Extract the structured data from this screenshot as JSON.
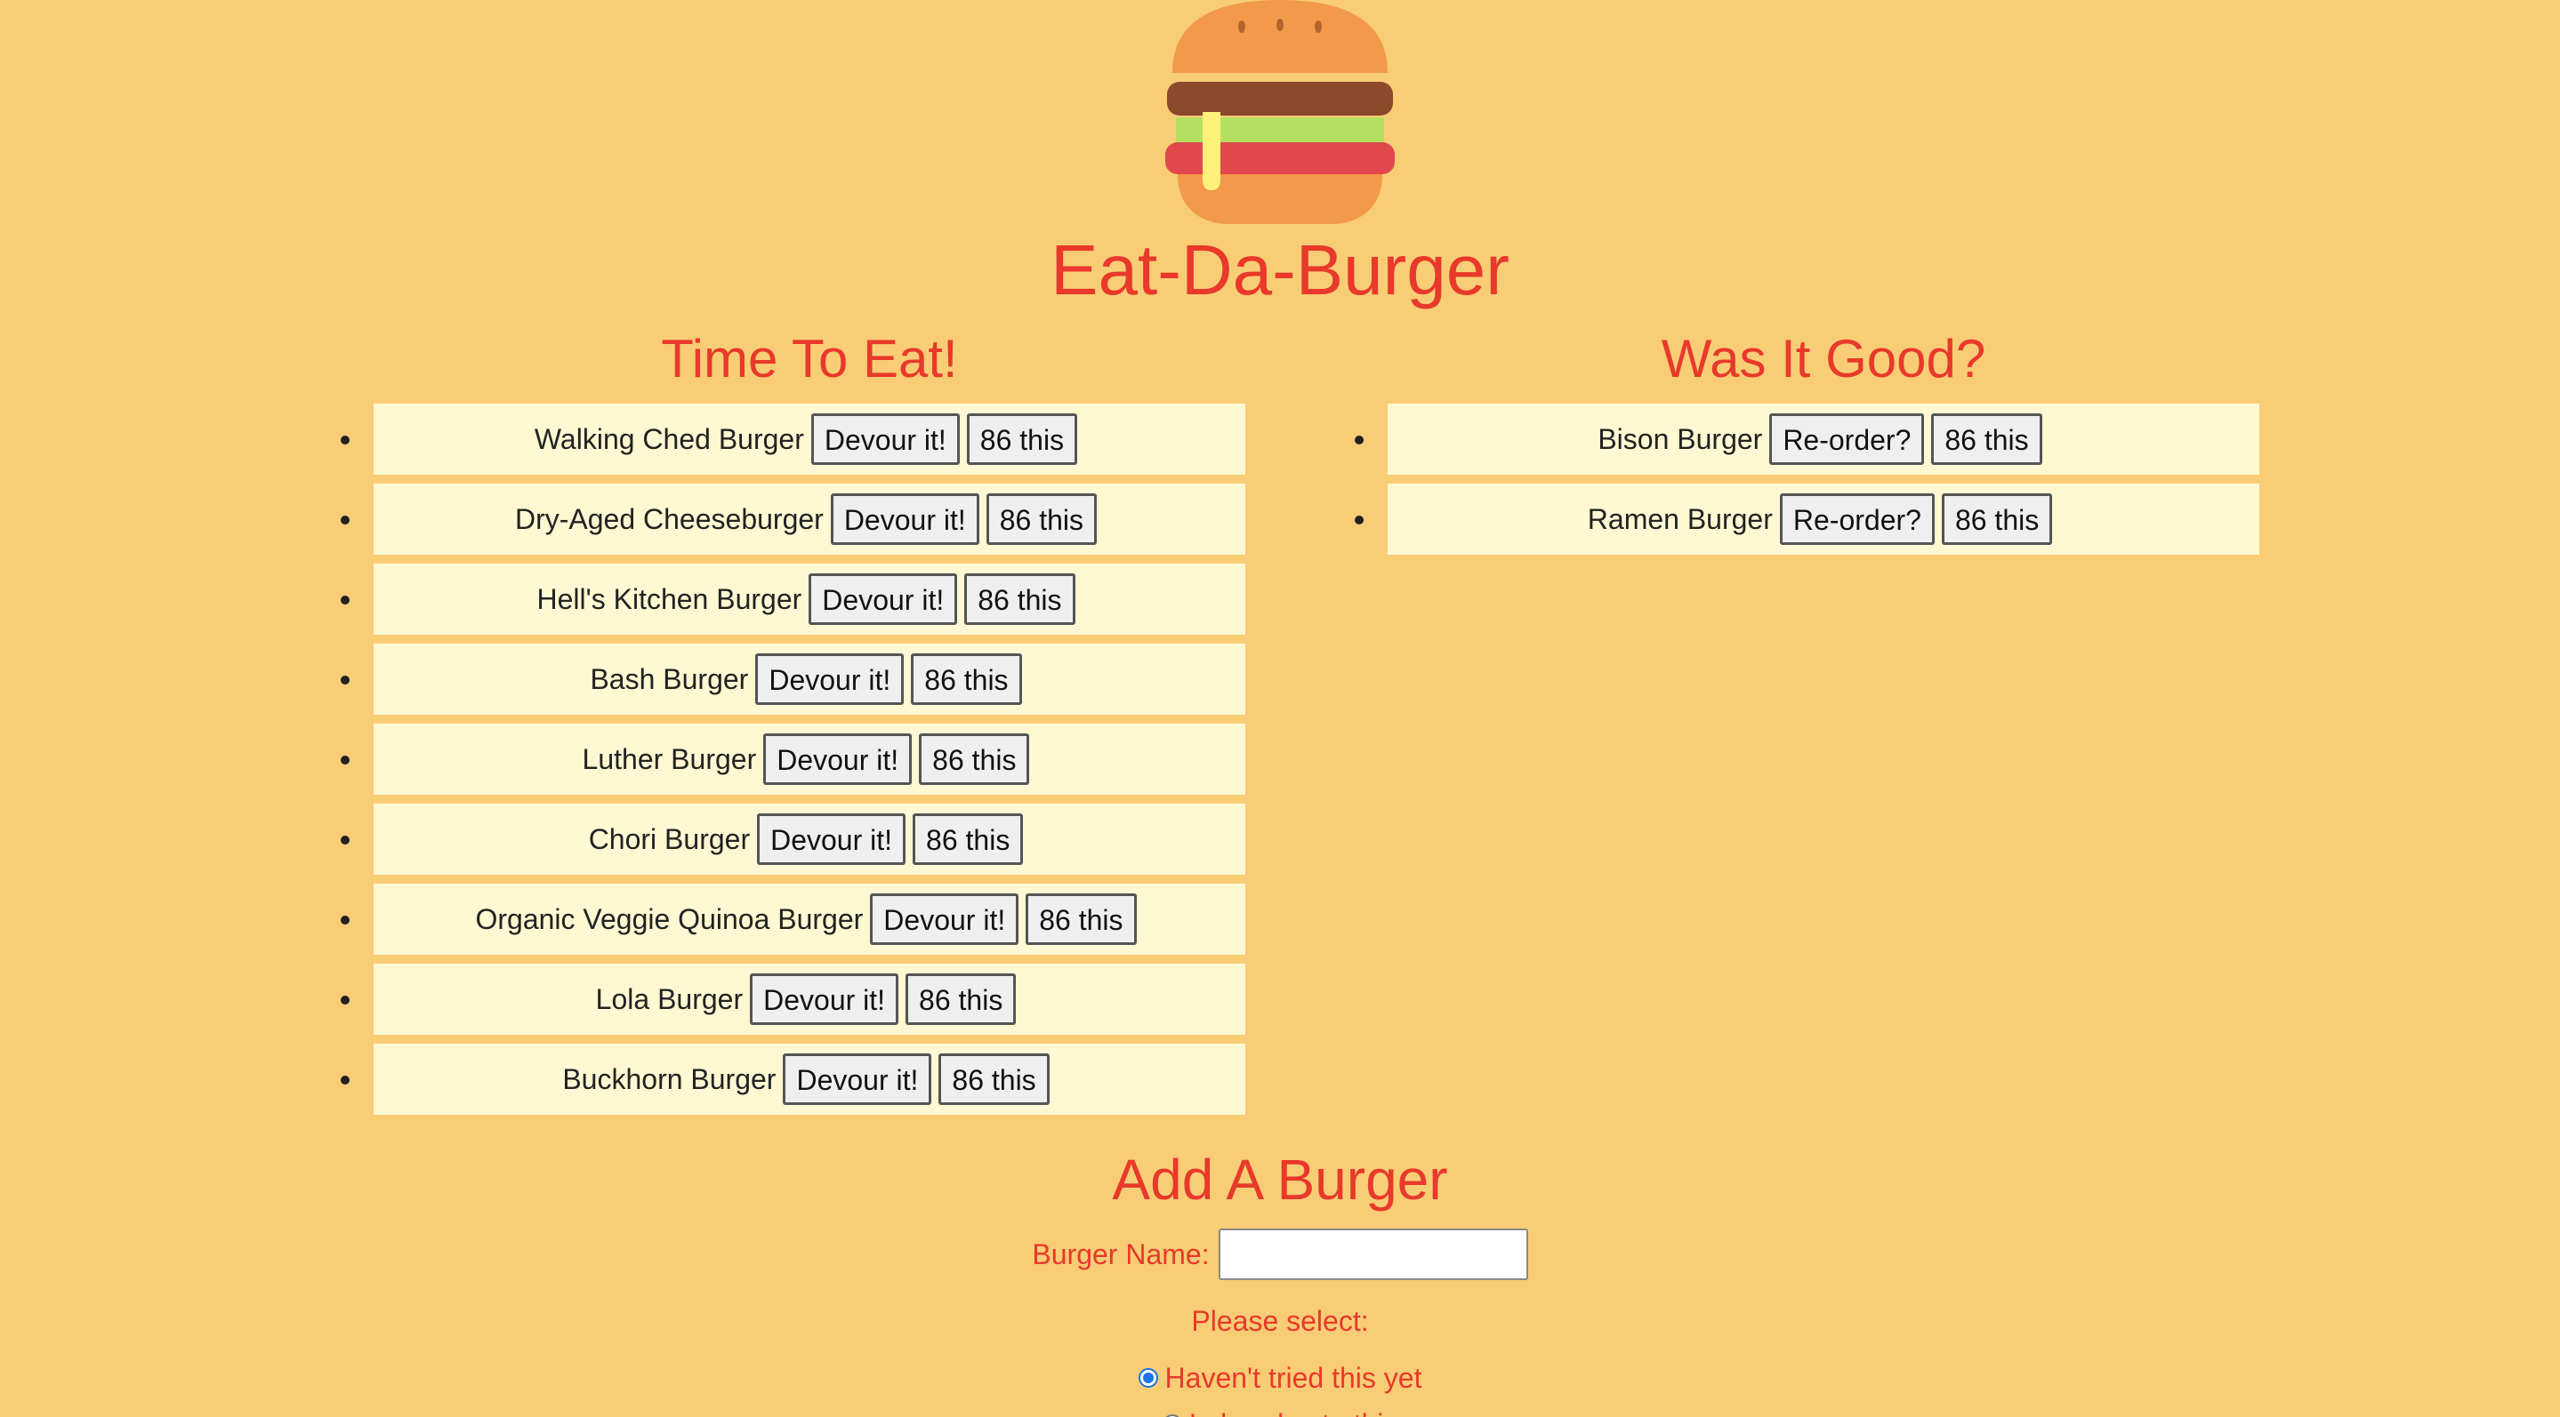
{
  "app": {
    "title": "Eat-Da-Burger"
  },
  "colors": {
    "background": "#f8cd76",
    "accent": "#e8392b",
    "item_background": "#fff8d2"
  },
  "to_eat": {
    "heading": "Time To Eat!",
    "items": [
      {
        "name": "Walking Ched Burger",
        "action": "Devour it!",
        "remove": "86 this"
      },
      {
        "name": "Dry-Aged Cheeseburger",
        "action": "Devour it!",
        "remove": "86 this"
      },
      {
        "name": "Hell's Kitchen Burger",
        "action": "Devour it!",
        "remove": "86 this"
      },
      {
        "name": "Bash Burger",
        "action": "Devour it!",
        "remove": "86 this"
      },
      {
        "name": "Luther Burger",
        "action": "Devour it!",
        "remove": "86 this"
      },
      {
        "name": "Chori Burger",
        "action": "Devour it!",
        "remove": "86 this"
      },
      {
        "name": "Organic Veggie Quinoa Burger",
        "action": "Devour it!",
        "remove": "86 this"
      },
      {
        "name": "Lola Burger",
        "action": "Devour it!",
        "remove": "86 this"
      },
      {
        "name": "Buckhorn Burger",
        "action": "Devour it!",
        "remove": "86 this"
      }
    ]
  },
  "eaten": {
    "heading": "Was It Good?",
    "items": [
      {
        "name": "Bison Burger",
        "action": "Re-order?",
        "remove": "86 this"
      },
      {
        "name": "Ramen Burger",
        "action": "Re-order?",
        "remove": "86 this"
      }
    ]
  },
  "add_form": {
    "heading": "Add A Burger",
    "name_label": "Burger Name:",
    "name_value": "",
    "select_label": "Please select:",
    "options": [
      {
        "label": "Haven't tried this yet",
        "checked": true
      },
      {
        "label": "I already ate this",
        "checked": false
      }
    ]
  }
}
